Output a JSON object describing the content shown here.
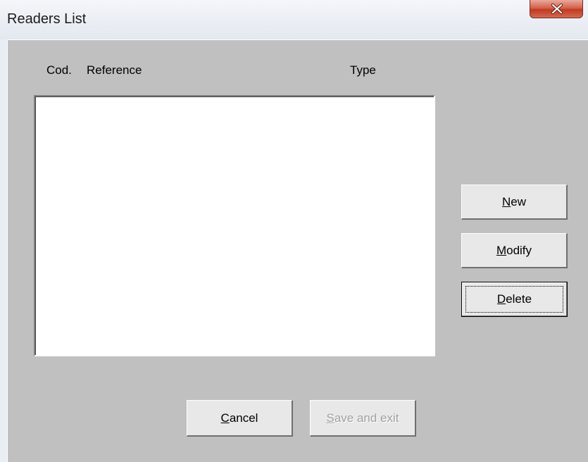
{
  "window": {
    "title": "Readers List"
  },
  "list": {
    "columns": [
      "Cod.",
      "Reference",
      "Type"
    ],
    "rows": []
  },
  "buttons": {
    "new": {
      "first": "N",
      "rest": "ew"
    },
    "modify": {
      "first": "M",
      "rest": "odify"
    },
    "delete": {
      "first": "D",
      "rest": "elete"
    },
    "cancel": {
      "first": "C",
      "rest": "ancel"
    },
    "save_exit": {
      "first": "S",
      "rest": "ave and exit"
    }
  },
  "colors": {
    "dialog_face": "#c0c0c0",
    "button_face": "#e8e8e8",
    "disabled_text": "#a0a0a0",
    "close_red": "#c23a22"
  }
}
